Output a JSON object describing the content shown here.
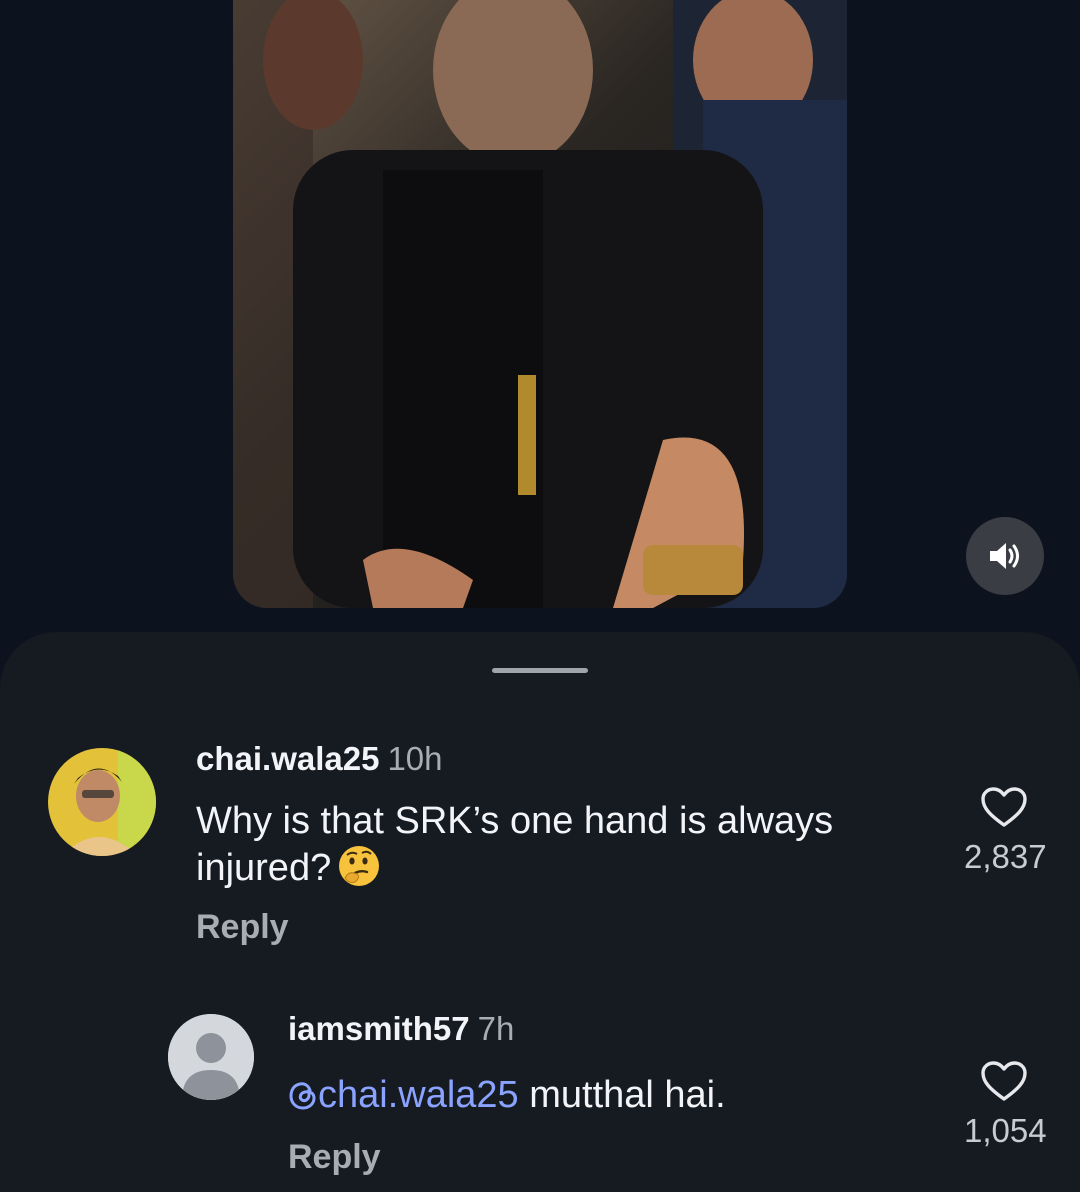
{
  "video": {
    "mute_icon": "speaker-volume-icon"
  },
  "comments": [
    {
      "username": "chai.wala25",
      "time": "10h",
      "text": "Why is that SRK’s one hand is always injured?",
      "emoji": "thinking-face",
      "reply_label": "Reply",
      "likes": "2,837"
    },
    {
      "username": "iamsmith57",
      "time": "7h",
      "mention": "chai.wala25",
      "text": " mutthal hai.",
      "reply_label": "Reply",
      "likes": "1,054"
    }
  ],
  "colors": {
    "background": "#0c121e",
    "sheet": "#161a21",
    "mention": "#8aa3ff",
    "muted_text": "#a8adb5"
  }
}
